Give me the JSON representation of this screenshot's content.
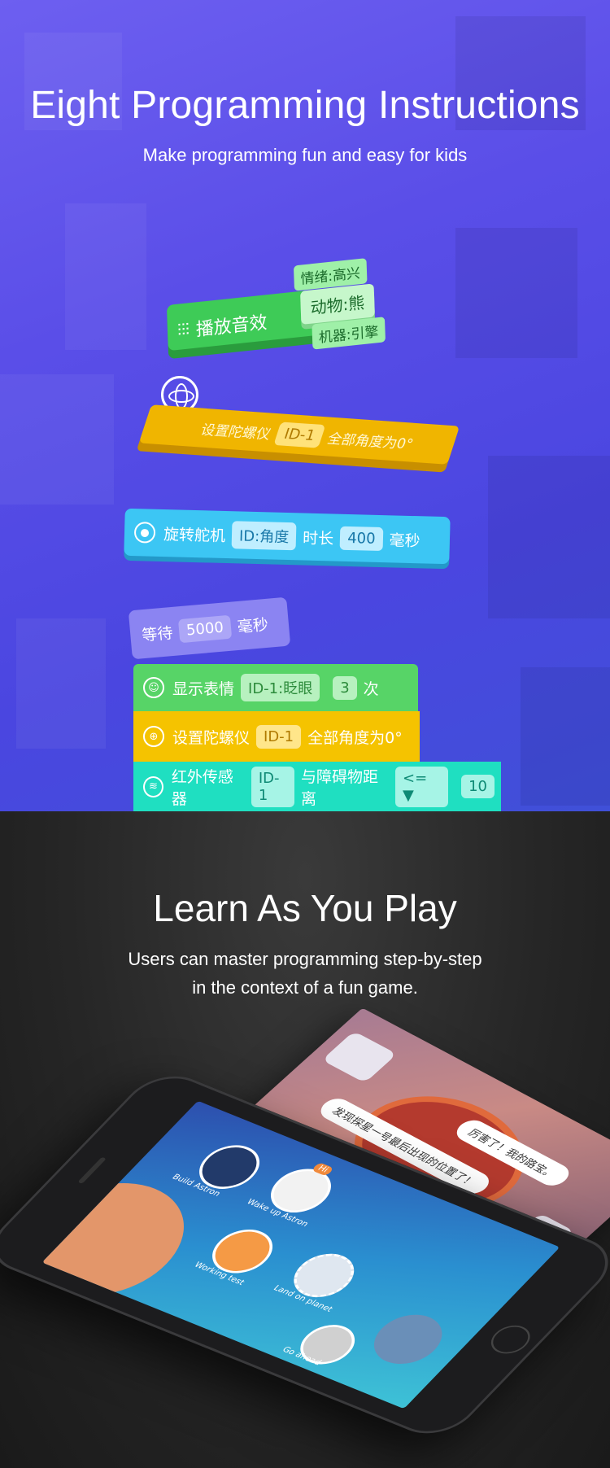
{
  "hero": {
    "title": "Eight Programming Instructions",
    "subtitle": "Make programming fun and easy for kids"
  },
  "blocks": {
    "sound": {
      "label": "播放音效",
      "options": [
        "情绪:高兴",
        "动物:熊",
        "机器:引擎"
      ],
      "color": "#4cd964"
    },
    "gyro_tilted": {
      "label": "设置陀螺仪",
      "slot": "ID-1",
      "tail": "全部角度为0°",
      "color": "#f5b800"
    },
    "servo": {
      "label": "旋转舵机",
      "slot1": "ID:角度",
      "mid": "时长",
      "slot2": "400",
      "tail": "毫秒",
      "color": "#3cc8f5"
    },
    "wait": {
      "label": "等待",
      "slot": "5000",
      "tail": "毫秒",
      "color": "#8b82f0"
    },
    "expression": {
      "label": "显示表情",
      "slot1": "ID-1:眨眼",
      "slot2": "3",
      "tail": "次",
      "color": "#5ad66a"
    },
    "gyro": {
      "label": "设置陀螺仪",
      "slot": "ID-1",
      "tail": "全部角度为0°",
      "color": "#f5c500"
    },
    "infrared": {
      "label": "红外传感器",
      "slot1": "ID-1",
      "mid": "与障碍物距离",
      "select": "<= ▼",
      "slot2": "10",
      "color": "#1ee0c0"
    }
  },
  "learn": {
    "title": "Learn As You Play",
    "subtitle_line1": "Users can master programming step-by-step",
    "subtitle_line2": "in the context of a fun game."
  },
  "game": {
    "bubble1": "厉害了！我的路宝。",
    "bubble2": "发现探星一号最后出现的位置了！",
    "levels": [
      "Build Astron",
      "Wake up Astron",
      "Working test",
      "Land on planet",
      "Go ahead"
    ],
    "hi": "Hi"
  }
}
